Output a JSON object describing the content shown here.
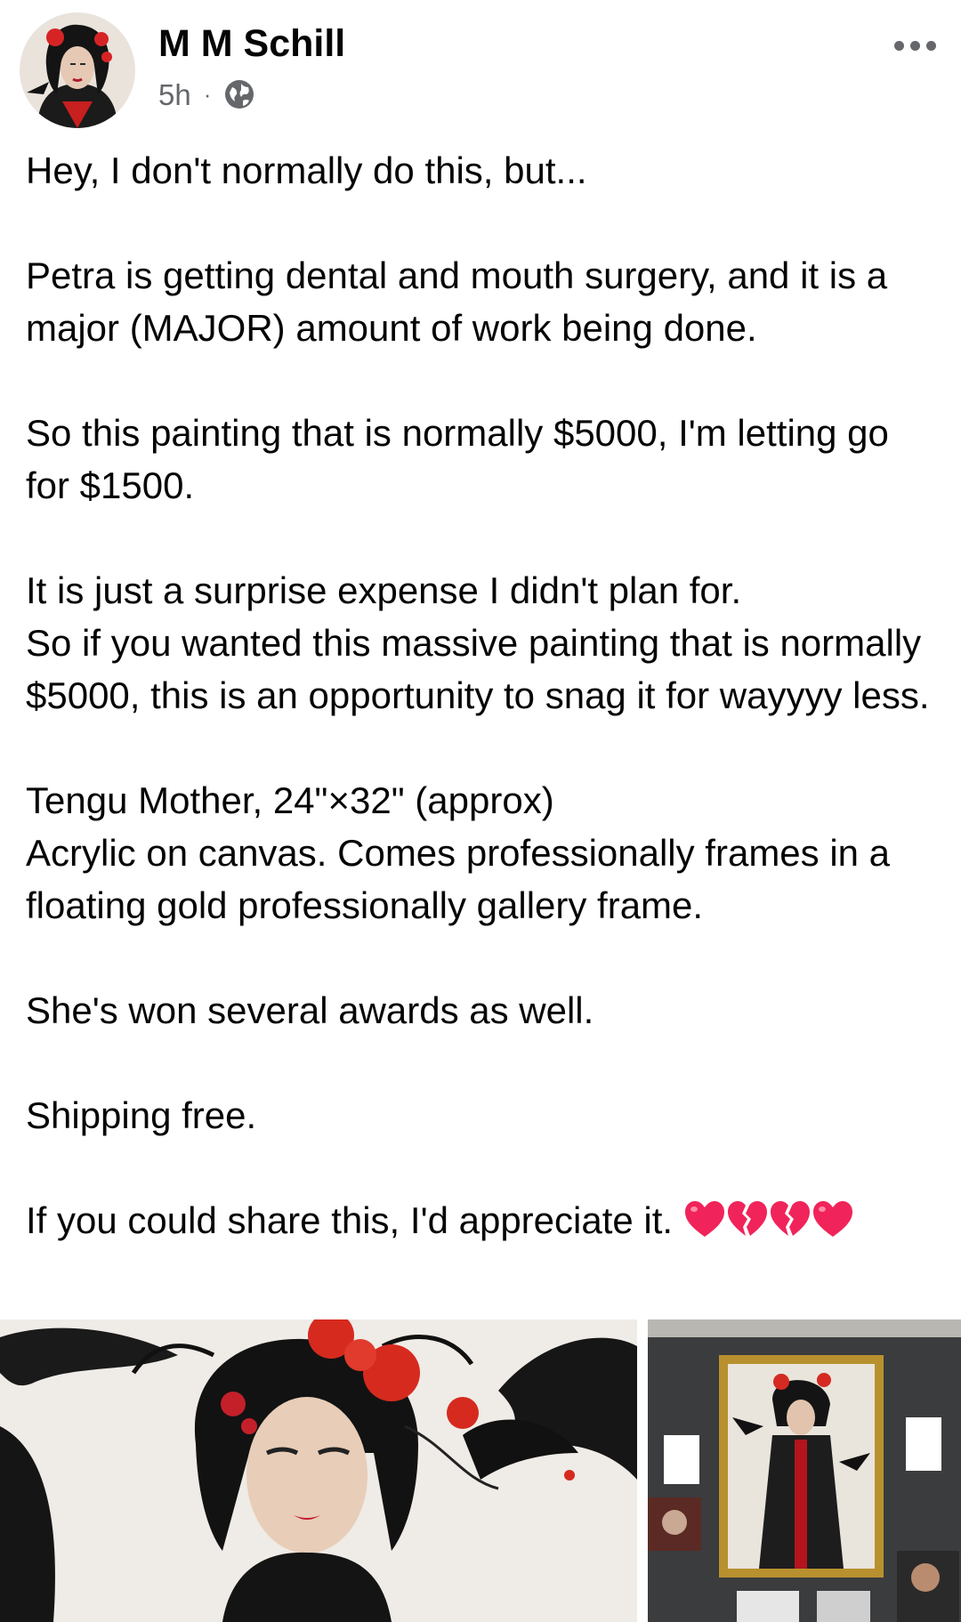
{
  "post": {
    "author": "M M Schill",
    "time": "5h",
    "separator": "·",
    "privacy_icon": "globe-icon",
    "more_icon": "more-options-icon",
    "text": {
      "line1": "Hey, I don't normally do this, but...",
      "para2": "Petra is getting dental and mouth surgery, and it is a major (MAJOR) amount of work being done.",
      "para3": "So this painting that is normally $5000, I'm letting go for $1500.",
      "para4a": "It is just a surprise expense I didn't plan for.",
      "para4b": "So if you wanted this massive painting that is normally $5000, this is an opportunity to snag it for wayyyy less.",
      "para5a": "Tengu Mother, 24\"×32\" (approx)",
      "para5b": "Acrylic on canvas. Comes professionally frames in a floating gold professionally gallery frame.",
      "para6": "She's won several awards as well.",
      "para7": "Shipping free.",
      "para8": "If you could share this, I'd appreciate it."
    },
    "emoji": [
      "red-heart",
      "broken-heart",
      "broken-heart",
      "red-heart"
    ]
  },
  "colors": {
    "text": "#050505",
    "meta": "#65676b",
    "heart": "#f0245a"
  }
}
